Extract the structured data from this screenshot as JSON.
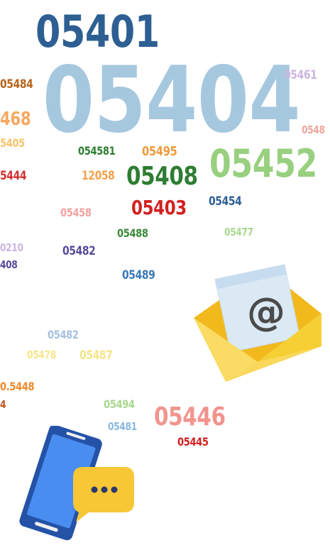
{
  "zip_codes": [
    "05401",
    "05404",
    "05484",
    "05461",
    "468",
    "0548",
    "5405",
    "054581",
    "05495",
    "05452",
    "5444",
    "12058",
    "05408",
    "05454",
    "05458",
    "05403",
    "05488",
    "05477",
    "0210",
    "408",
    "05482",
    "05489",
    "05482",
    "05478",
    "05487",
    "0.5448",
    "4",
    "05494",
    "05481",
    "05446",
    "05445"
  ],
  "icons": {
    "envelope": "envelope-email-icon",
    "phone": "phone-chat-icon",
    "at_symbol": "@"
  },
  "colors": {
    "envelope_yellow": "#f9d64a",
    "envelope_dark": "#f2b91d",
    "letter": "#dbe9f5",
    "phone_blue": "#3b7fe0",
    "bubble_yellow": "#f7c736"
  }
}
